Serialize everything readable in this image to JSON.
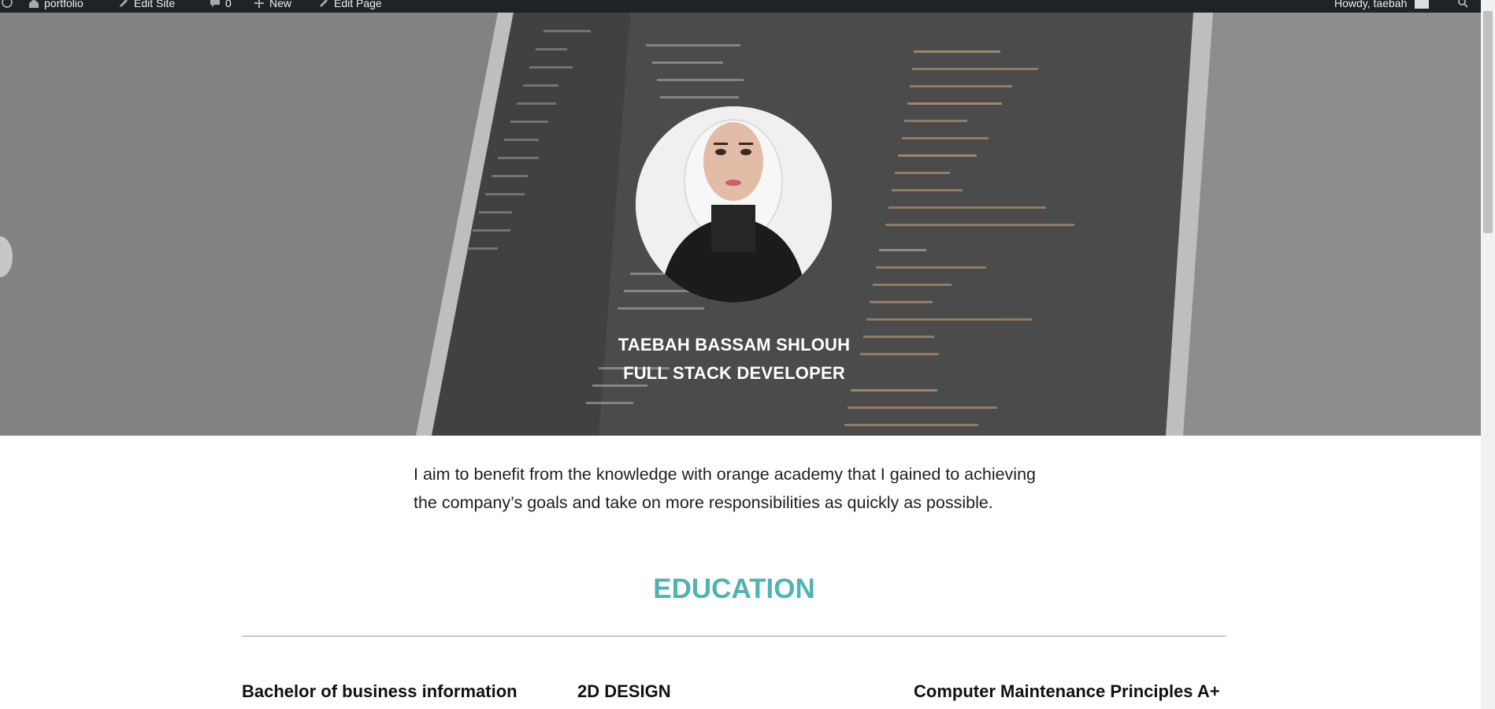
{
  "admin_bar": {
    "items": [
      {
        "label": "portfolio",
        "icon": "home-icon"
      },
      {
        "label": "Edit Site",
        "icon": "pencil-icon"
      },
      {
        "label": "0",
        "icon": "comment-icon"
      },
      {
        "label": "New",
        "icon": "plus-icon"
      },
      {
        "label": "Edit Page",
        "icon": "pencil-icon"
      }
    ],
    "greeting": "Howdy, taebah"
  },
  "hero": {
    "name": "TAEBAH BASSAM SHLOUH",
    "role": "FULL STACK DEVELOPER"
  },
  "objective": "I aim to benefit from the knowledge with orange academy that I gained to achieving the company’s goals and take on more responsibilities as quickly as possible.",
  "education": {
    "heading": "EDUCATION",
    "items": [
      {
        "title": "Bachelor of business information"
      },
      {
        "title": "2D DESIGN"
      },
      {
        "title": "Computer Maintenance Principles A+"
      }
    ]
  },
  "colors": {
    "accent": "#4fb3b4",
    "admin_bar": "#1d2327"
  }
}
